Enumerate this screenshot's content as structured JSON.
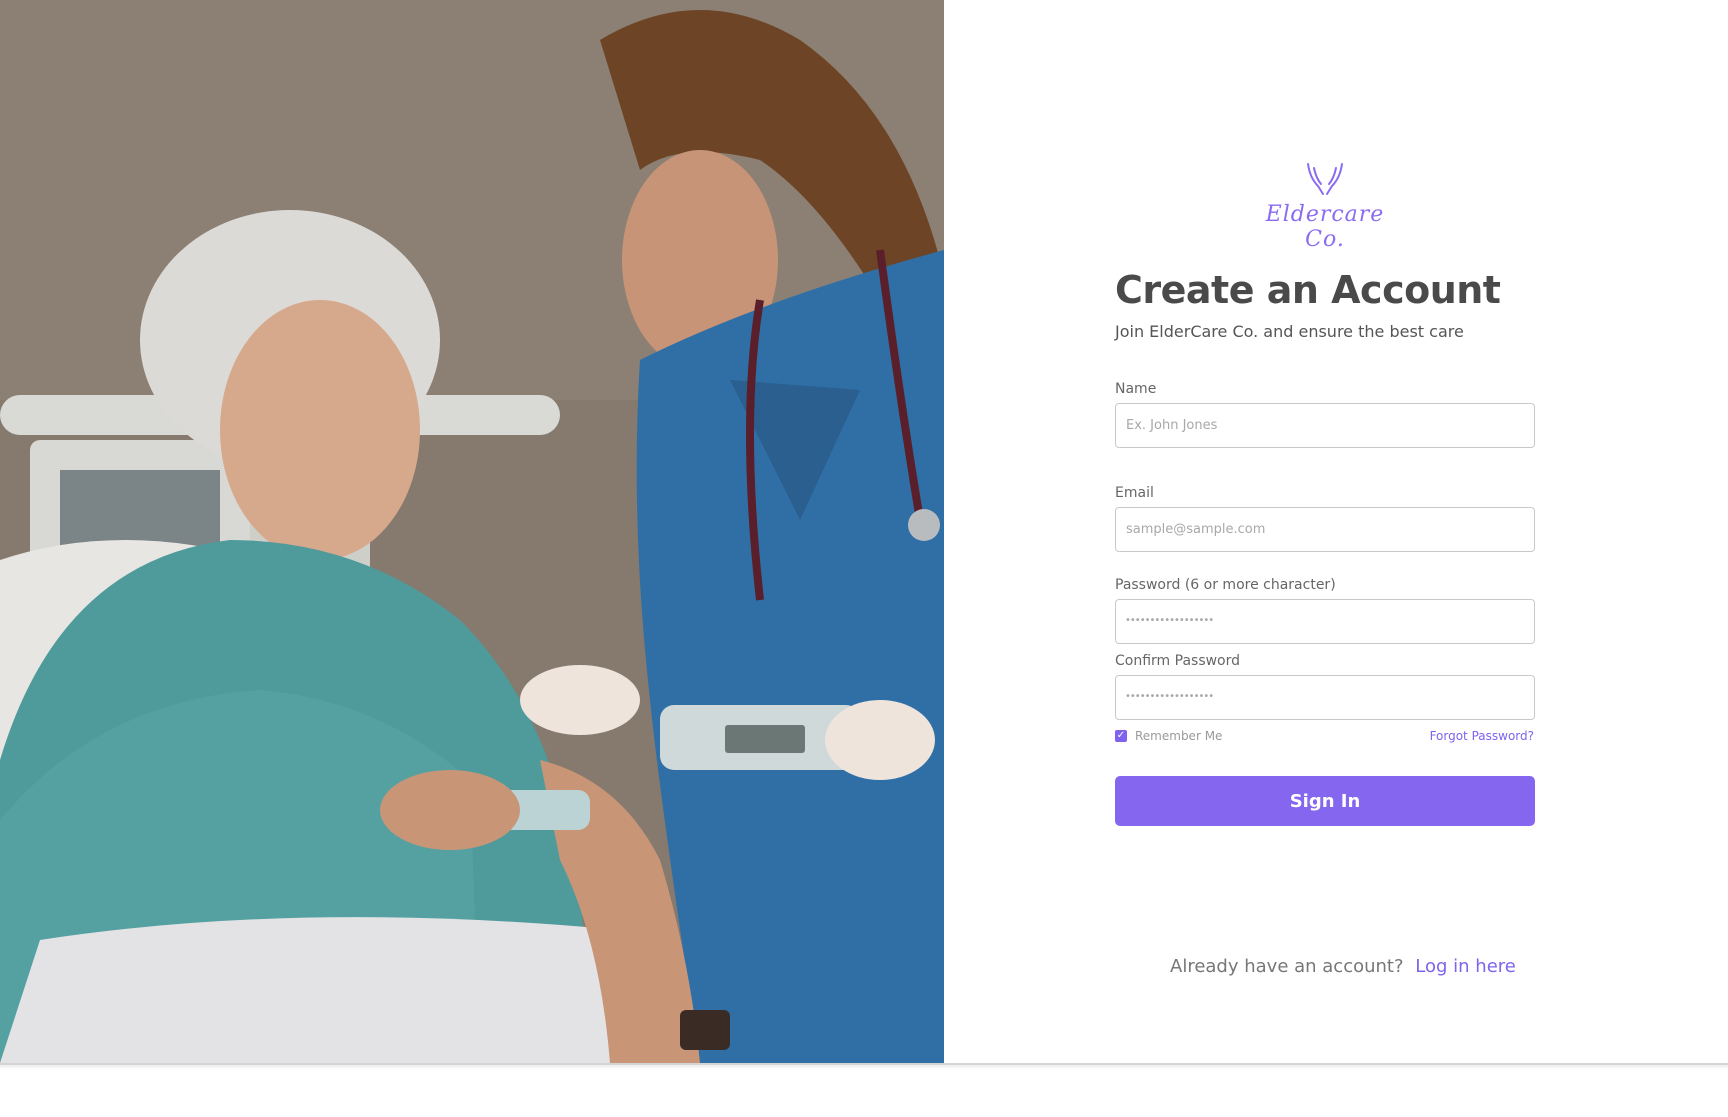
{
  "brand": {
    "logo_icon": "caring-hands-icon",
    "name": "Eldercare Co.",
    "accent_color": "#8566ee"
  },
  "photo": {
    "description_icon": "nurse-with-elderly-patient-photo"
  },
  "form": {
    "title": "Create an Account",
    "subtitle": "Join ElderCare Co. and ensure the best care",
    "name_label": "Name",
    "name_placeholder": "Ex. John Jones",
    "email_label": "Email",
    "email_placeholder": "sample@sample.com",
    "password_label": "Password (6 or more character)",
    "password_mask": "••••••••••••••••••",
    "confirm_label": "Confirm Password",
    "confirm_mask": "••••••••••••••••••",
    "remember_label": "Remember Me",
    "remember_checked": true,
    "forgot_label": "Forgot Password?",
    "submit_label": "Sign In"
  },
  "footer": {
    "prompt": "Already have an account?",
    "login_link": "Log in here"
  }
}
